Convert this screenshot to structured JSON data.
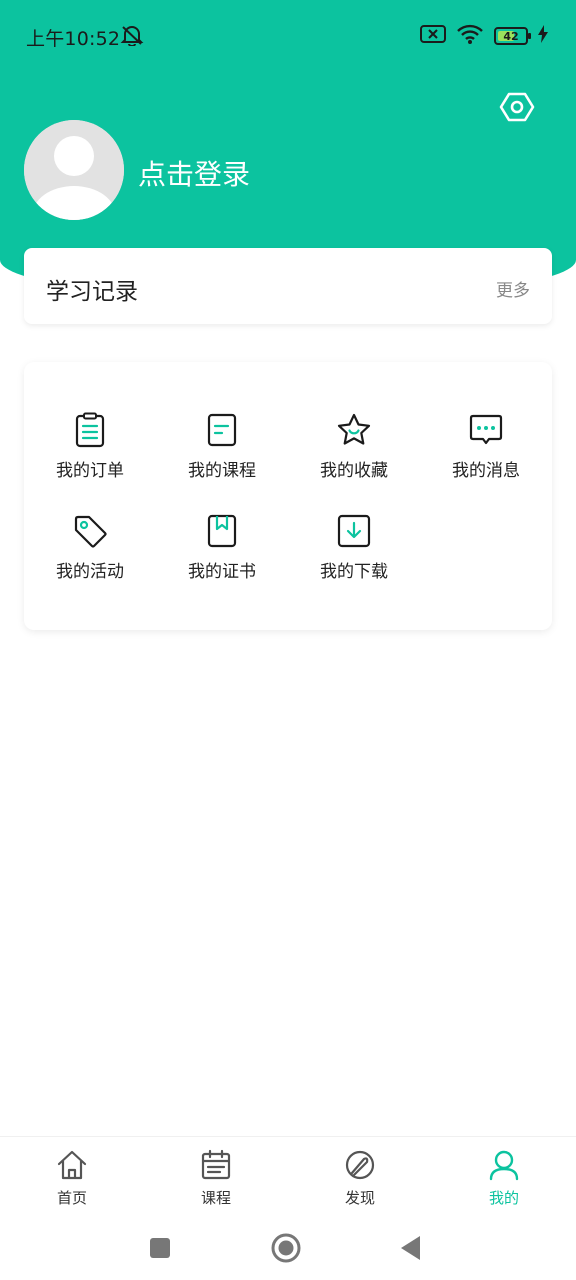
{
  "status_bar": {
    "time": "上午10:52",
    "battery_level": "42",
    "icons": [
      "bell-off-icon",
      "sim-x-icon",
      "wifi-icon",
      "battery-icon",
      "charging-icon"
    ]
  },
  "profile": {
    "login_text": "点击登录",
    "settings_icon": "hexagon-gear-icon"
  },
  "learning_record": {
    "title": "学习记录",
    "more": "更多"
  },
  "menu": {
    "items": [
      {
        "label": "我的订单",
        "icon": "clipboard-icon"
      },
      {
        "label": "我的课程",
        "icon": "document-icon"
      },
      {
        "label": "我的收藏",
        "icon": "star-icon"
      },
      {
        "label": "我的消息",
        "icon": "chat-icon"
      },
      {
        "label": "我的活动",
        "icon": "tag-icon"
      },
      {
        "label": "我的证书",
        "icon": "bookmark-icon"
      },
      {
        "label": "我的下载",
        "icon": "download-icon"
      }
    ]
  },
  "bottom_nav": {
    "active": "我的",
    "items": [
      {
        "label": "首页",
        "icon": "home-icon"
      },
      {
        "label": "课程",
        "icon": "calendar-icon"
      },
      {
        "label": "发现",
        "icon": "discover-icon"
      },
      {
        "label": "我的",
        "icon": "user-icon"
      }
    ]
  },
  "colors": {
    "brand": "#0cc39f",
    "text": "#222222",
    "muted": "#888888"
  }
}
